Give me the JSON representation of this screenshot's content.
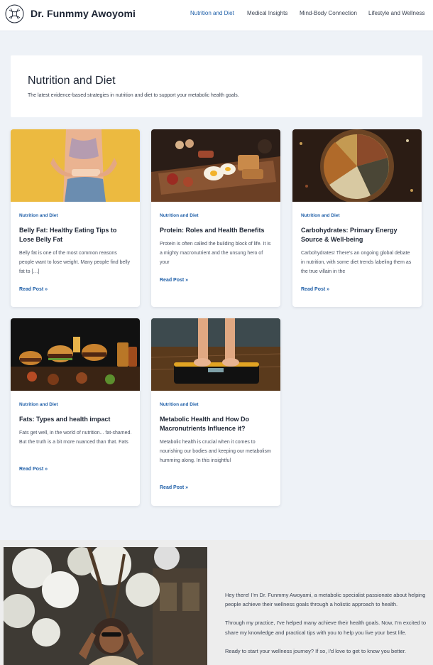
{
  "header": {
    "site_title": "Dr. Funmmy Awoyomi",
    "nav": [
      {
        "label": "Nutrition and Diet",
        "active": true
      },
      {
        "label": "Medical Insights",
        "active": false
      },
      {
        "label": "Mind-Body Connection",
        "active": false
      },
      {
        "label": "Lifestyle and Wellness",
        "active": false
      }
    ]
  },
  "intro": {
    "title": "Nutrition and Diet",
    "subtitle": "The latest evidence-based strategies in nutrition and diet to support your metabolic health goals."
  },
  "posts": [
    {
      "category": "Nutrition and Diet",
      "title": "Belly Fat: Healthy Eating Tips to Lose Belly Fat",
      "excerpt": "Belly fat is one of the most common reasons people want to lose weight. Many people find belly fat to […]",
      "read_more": "Read Post »",
      "image": "woman-measuring-waist-photo"
    },
    {
      "category": "Nutrition and Diet",
      "title": "Protein: Roles and Health Benefits",
      "excerpt": "Protein is often called the building block of life. It is a mighty macronutrient and the unsung hero of your",
      "read_more": "Read Post »",
      "image": "breakfast-board-photo"
    },
    {
      "category": "Nutrition and Diet",
      "title": "Carbohydrates: Primary Energy Source & Well-being",
      "excerpt": "Carbohydrates! There's an ongoing global debate in nutrition, with some diet trends labeling them as the true villain in the",
      "read_more": "Read Post »",
      "image": "grains-bowl-photo"
    },
    {
      "category": "Nutrition and Diet",
      "title": "Fats: Types and health impact",
      "excerpt": "Fats get well, in the world of nutrition... fat-shamed. But the truth is a bit more nuanced than that. Fats",
      "read_more": "Read Post »",
      "image": "fast-food-spread-photo"
    },
    {
      "category": "Nutrition and Diet",
      "title": "Metabolic Health and How Do Macronutrients Influence it?",
      "excerpt": "Metabolic health is crucial when it comes to nourishing our bodies and keeping our metabolism humming along. In this insightful",
      "read_more": "Read Post »",
      "image": "feet-on-scale-photo"
    }
  ],
  "about": {
    "paragraphs": [
      "Hey there! I'm Dr. Funmmy Awoyami, a metabolic specialist passionate about helping people achieve their wellness goals through a holistic approach to health.",
      "Through my practice, I've helped many achieve their health goals. Now, I'm excited to share my knowledge and practical tips with you to help you live your best life.",
      "Ready to start your wellness journey? If so, I'd love to get to know you better."
    ],
    "image": "smiling-woman-under-flowers-photo"
  },
  "colors": {
    "accent": "#1f5fa8",
    "page_bg": "#eef2f7",
    "text": "#1c2433"
  }
}
